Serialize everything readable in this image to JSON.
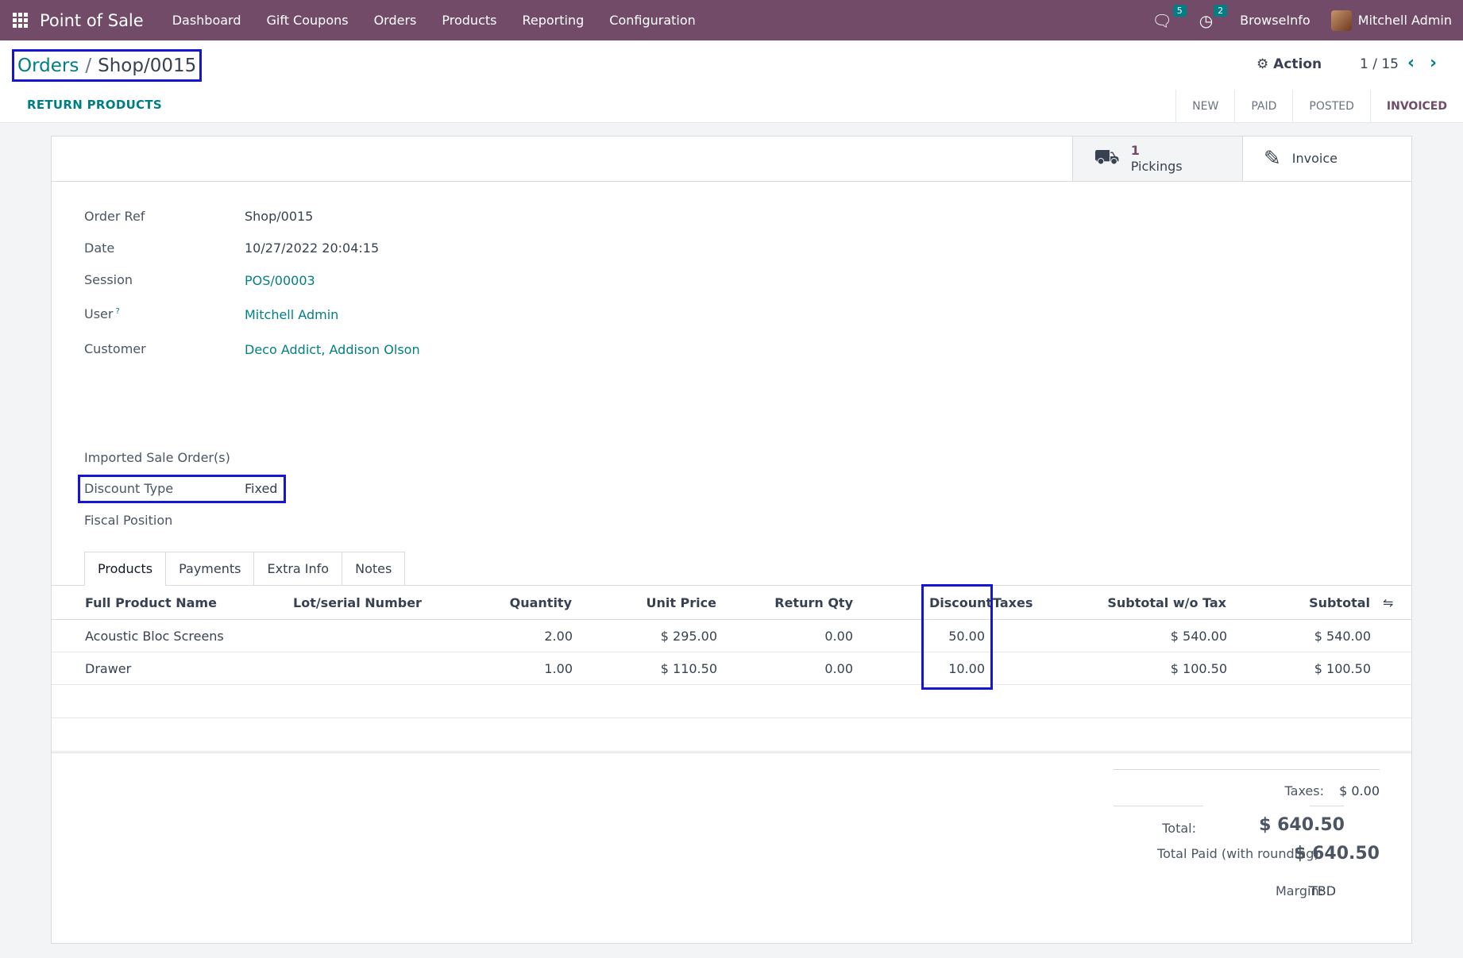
{
  "navbar": {
    "brand": "Point of Sale",
    "menu": [
      "Dashboard",
      "Gift Coupons",
      "Orders",
      "Products",
      "Reporting",
      "Configuration"
    ],
    "messages_count": "5",
    "activities_count": "2",
    "company": "BrowseInfo",
    "user": "Mitchell Admin",
    "icons": {
      "apps": "apps-grid-icon",
      "messages": "chat-icon",
      "activities": "clock-icon"
    }
  },
  "control": {
    "breadcrumb_parent": "Orders",
    "breadcrumb_separator": "/",
    "breadcrumb_current": "Shop/0015",
    "action_label": "Action",
    "pager": "1 / 15",
    "return_button": "RETURN PRODUCTS",
    "stages": [
      "NEW",
      "PAID",
      "POSTED",
      "INVOICED"
    ],
    "active_stage": "INVOICED"
  },
  "smart_buttons": {
    "pickings_value": "1",
    "pickings_label": "Pickings",
    "invoice_label": "Invoice"
  },
  "fields": {
    "order_ref_label": "Order Ref",
    "order_ref": "Shop/0015",
    "date_label": "Date",
    "date": "10/27/2022 20:04:15",
    "session_label": "Session",
    "session": "POS/00003",
    "user_label": "User",
    "user_help": "?",
    "user": "Mitchell Admin",
    "customer_label": "Customer",
    "customer": "Deco Addict, Addison Olson",
    "imported_label": "Imported Sale Order(s)",
    "discount_type_label": "Discount Type",
    "discount_type": "Fixed",
    "fiscal_position_label": "Fiscal Position"
  },
  "tabs": [
    "Products",
    "Payments",
    "Extra Info",
    "Notes"
  ],
  "table": {
    "headers": {
      "name": "Full Product Name",
      "lot": "Lot/serial Number",
      "qty": "Quantity",
      "price": "Unit Price",
      "return_qty": "Return Qty",
      "discount": "Discount",
      "taxes": "Taxes",
      "subtotal_wo": "Subtotal w/o Tax",
      "subtotal": "Subtotal"
    },
    "rows": [
      {
        "name": "Acoustic Bloc Screens",
        "lot": "",
        "qty": "2.00",
        "price": "$ 295.00",
        "return_qty": "0.00",
        "discount": "50.00",
        "taxes": "",
        "subtotal_wo": "$ 540.00",
        "subtotal": "$ 540.00"
      },
      {
        "name": "Drawer",
        "lot": "",
        "qty": "1.00",
        "price": "$ 110.50",
        "return_qty": "0.00",
        "discount": "10.00",
        "taxes": "",
        "subtotal_wo": "$ 100.50",
        "subtotal": "$ 100.50"
      }
    ]
  },
  "totals": {
    "taxes_label": "Taxes:",
    "taxes": "$ 0.00",
    "total_label": "Total:",
    "total": "$ 640.50",
    "paid_label": "Total Paid (with rounding):",
    "paid": "$ 640.50",
    "margin_label": "Margin:",
    "margin": "TBD"
  }
}
